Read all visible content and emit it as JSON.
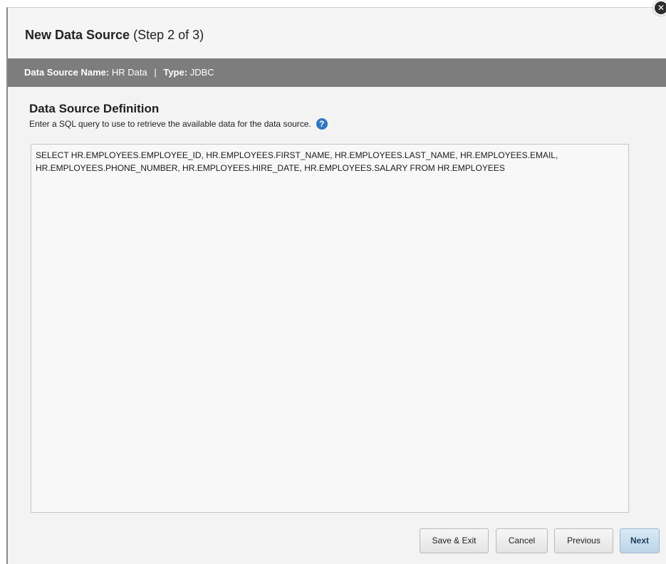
{
  "dialog": {
    "title": "New Data Source",
    "step": "(Step 2 of 3)",
    "close_glyph": "✕"
  },
  "info_bar": {
    "name_label": "Data Source Name:",
    "name_value": "HR Data",
    "separator": "|",
    "type_label": "Type:",
    "type_value": "JDBC",
    "background": "#7d7d7d"
  },
  "definition": {
    "title": "Data Source Definition",
    "description": "Enter a SQL query to use to retrieve the available data for the data source.",
    "help_glyph": "?",
    "sql_query": "SELECT HR.EMPLOYEES.EMPLOYEE_ID, HR.EMPLOYEES.FIRST_NAME, HR.EMPLOYEES.LAST_NAME, HR.EMPLOYEES.EMAIL, HR.EMPLOYEES.PHONE_NUMBER, HR.EMPLOYEES.HIRE_DATE, HR.EMPLOYEES.SALARY FROM HR.EMPLOYEES"
  },
  "buttons": {
    "save_exit": "Save & Exit",
    "cancel": "Cancel",
    "previous": "Previous",
    "next": "Next"
  },
  "icons": {
    "close": "close-icon",
    "help": "help-icon"
  },
  "colors": {
    "accent": "#2f77c3",
    "next_button": "#bcd5ea"
  }
}
